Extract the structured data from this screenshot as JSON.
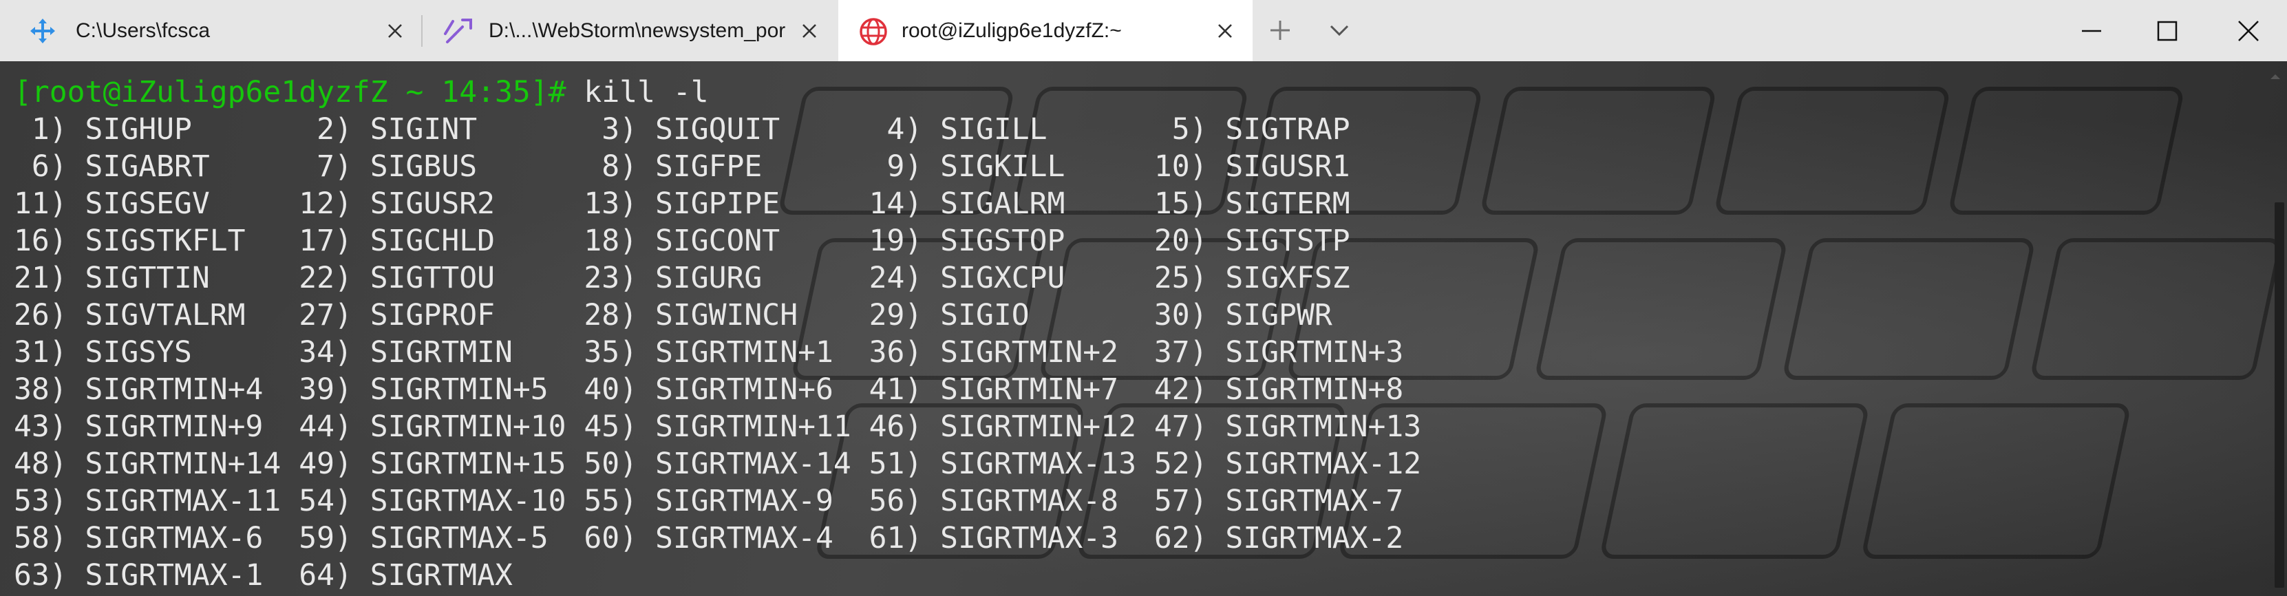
{
  "tabs": [
    {
      "title": "C:\\Users\\fcsca",
      "icon": "powershell-move-icon",
      "active": false
    },
    {
      "title": "D:\\...\\WebStorm\\newsystem_por",
      "icon": "visual-studio-icon",
      "active": false
    },
    {
      "title": "root@iZuligp6e1dyzfZ:~",
      "icon": "linux-globe-icon",
      "active": true
    }
  ],
  "titlebar": {
    "new_tab_icon": "plus-icon",
    "dropdown_icon": "chevron-down-icon",
    "minimize_icon": "minimize-icon",
    "maximize_icon": "maximize-icon",
    "close_icon": "close-icon"
  },
  "terminal": {
    "prompt": "[root@iZuligp6e1dyzfZ ~ 14:35]#",
    "command": " kill -l",
    "output_lines": [
      " 1) SIGHUP\t 2) SIGINT\t 3) SIGQUIT\t 4) SIGILL\t 5) SIGTRAP",
      " 6) SIGABRT\t 7) SIGBUS\t 8) SIGFPE\t 9) SIGKILL\t10) SIGUSR1",
      "11) SIGSEGV\t12) SIGUSR2\t13) SIGPIPE\t14) SIGALRM\t15) SIGTERM",
      "16) SIGSTKFLT\t17) SIGCHLD\t18) SIGCONT\t19) SIGSTOP\t20) SIGTSTP",
      "21) SIGTTIN\t22) SIGTTOU\t23) SIGURG\t24) SIGXCPU\t25) SIGXFSZ",
      "26) SIGVTALRM\t27) SIGPROF\t28) SIGWINCH\t29) SIGIO\t30) SIGPWR",
      "31) SIGSYS\t34) SIGRTMIN\t35) SIGRTMIN+1\t36) SIGRTMIN+2\t37) SIGRTMIN+3",
      "38) SIGRTMIN+4\t39) SIGRTMIN+5\t40) SIGRTMIN+6\t41) SIGRTMIN+7\t42) SIGRTMIN+8",
      "43) SIGRTMIN+9\t44) SIGRTMIN+10\t45) SIGRTMIN+11\t46) SIGRTMIN+12\t47) SIGRTMIN+13",
      "48) SIGRTMIN+14\t49) SIGRTMIN+15\t50) SIGRTMAX-14\t51) SIGRTMAX-13\t52) SIGRTMAX-12",
      "53) SIGRTMAX-11\t54) SIGRTMAX-10\t55) SIGRTMAX-9\t56) SIGRTMAX-8\t57) SIGRTMAX-7",
      "58) SIGRTMAX-6\t59) SIGRTMAX-5\t60) SIGRTMAX-4\t61) SIGRTMAX-3\t62) SIGRTMAX-2",
      "63) SIGRTMAX-1\t64) SIGRTMAX"
    ]
  },
  "colors": {
    "prompt": "#16c60c",
    "terminal_text": "#e8e8e8",
    "titlebar_bg": "#e6e6e6",
    "active_tab_bg": "#ffffff",
    "linux_icon": "#e0313b",
    "vs_icon": "#8a5cd6",
    "ps_icon": "#2f8fe6"
  }
}
